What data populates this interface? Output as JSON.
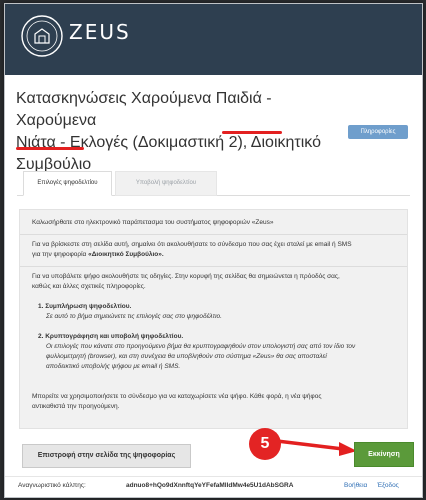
{
  "header": {
    "logo_text": "ZEUS",
    "logo_ring_text": "DIGITAL VOTING"
  },
  "page_title": {
    "line1": "Κατασκηνώσεις Χαρούμενα Παιδιά - Χαρούμενα",
    "line2": "Νιάτα - Εκλογές (Δοκιμαστική 2), Διοικητικό",
    "line3": "Συμβούλιο"
  },
  "info_button": "Πληροφορίες",
  "tabs": [
    {
      "label": "Επιλογές ψηφοδελτίου"
    },
    {
      "label": "Υποβολή ψηφοδελτίου"
    }
  ],
  "content": {
    "welcome": "Καλωσήρθατε στο ηλεκτρονικό παράπετασμα του συστήματος ψηφοφοριών «Zeus»",
    "p1_line1": "Για να βρίσκεστε στη σελίδα αυτή, σημαίνει ότι ακολουθήσατε το σύνδεσμο που σας έχει σταλεί με email ή SMS",
    "p1_line2_prefix": "για την ψηφοφορία ",
    "p1_line2_bold": "«Διοικητικό Συμβούλιο».",
    "p2_line1": "Για να υποβάλετε ψήφο ακολουθήστε τις οδηγίες. Στην κορυφή της σελίδας θα σημειώνεται η πρόοδός σας,",
    "p2_line2": "καθώς και άλλες σχετικές πληροφορίες.",
    "step1_title": "1. Συμπλήρωση ψηφοδελτίου.",
    "step1_desc": "Σε αυτό το βήμα σημειώνετε τις επιλογές σας στο ψηφοδέλτιο.",
    "step2_title": "2. Κρυπτογράφηση και υποβολή ψηφοδελτίου.",
    "step2_desc_1": "Οι επιλογές που κάνατε στο προηγούμενο βήμα θα κρυπτογραφηθούν στον υπολογιστή σας από τον ίδιο τον",
    "step2_desc_2": "φυλλομετρητή (browser), και στη συνέχεια θα υποβληθούν στο σύστημα «Zeus» θα σας αποσταλεί",
    "step2_desc_3": "αποδεικτικό υποβολής ψήφου με email ή SMS.",
    "p3_line1": "Μπορείτε να χρησιμοποιήσετε το σύνδεσμο για να καταχωρίσετε νέα ψήφο. Κάθε φορά, η νέα ψήφος",
    "p3_line2": "αντικαθιστά την προηγούμενη."
  },
  "buttons": {
    "return": "Επιστροφή στην σελίδα της ψηφοφορίας",
    "start": "Εκκίνηση"
  },
  "callout": "5",
  "footer": {
    "label": "Αναγνωριστικό κάλπης:",
    "code": "adnuo8+hQo9dXnnftqYeYFefaMlldMw4e5U1dAbSGRA",
    "help": "Βοήθεια",
    "exit": "Έξοδος"
  },
  "colors": {
    "header_bg": "#2e3f50",
    "start_button": "#5b9a3a",
    "info_button": "#6f9ecc",
    "annotation_red": "#e32020",
    "link_blue": "#2f6fb5"
  }
}
